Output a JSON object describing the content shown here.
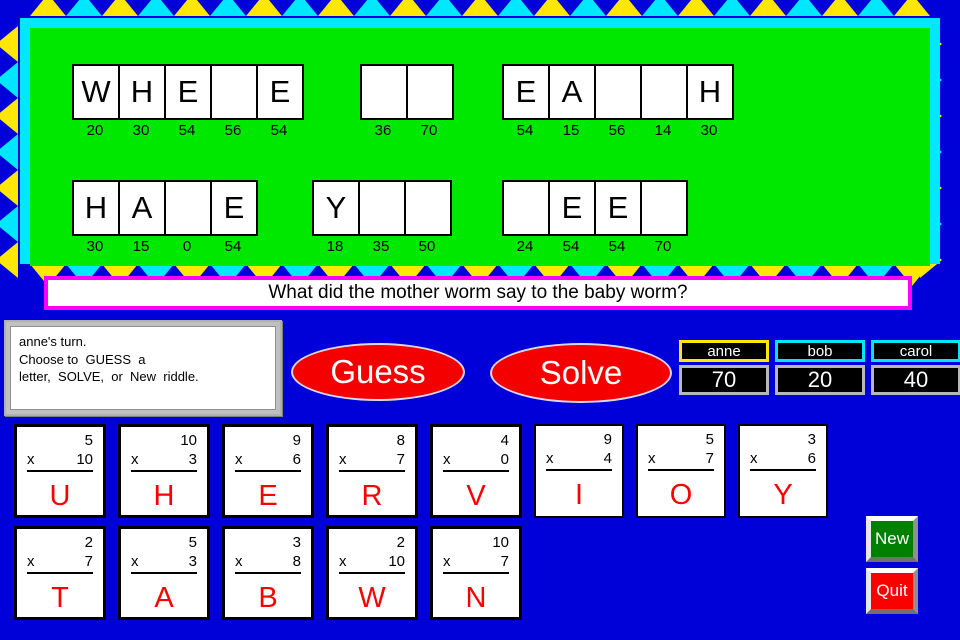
{
  "window": {
    "title": "Math Riddle Game"
  },
  "colors": {
    "background": "#0000d8",
    "panel": "#00e800",
    "frame_yellow": "#ffe800",
    "frame_cyan": "#00e8ff",
    "question_border": "#ff00ff",
    "button_red": "#f40000",
    "letter_red": "#fc0000",
    "new_green": "#008000",
    "active_player": "#ffe800",
    "inactive_player": "#00e8f8"
  },
  "puzzle": {
    "rows": [
      {
        "groups": [
          {
            "letters": [
              "W",
              "H",
              "E",
              "",
              "E"
            ],
            "numbers": [
              "20",
              "30",
              "54",
              "56",
              "54"
            ]
          },
          {
            "letters": [
              "",
              ""
            ],
            "numbers": [
              "36",
              "70"
            ]
          },
          {
            "letters": [
              "E",
              "A",
              "",
              "",
              "H"
            ],
            "numbers": [
              "54",
              "15",
              "56",
              "14",
              "30"
            ]
          }
        ]
      },
      {
        "groups": [
          {
            "letters": [
              "H",
              "A",
              "",
              "E"
            ],
            "numbers": [
              "30",
              "15",
              "0",
              "54"
            ]
          },
          {
            "letters": [
              "Y",
              "",
              ""
            ],
            "numbers": [
              "18",
              "35",
              "50"
            ]
          },
          {
            "letters": [
              "",
              "E",
              "E",
              ""
            ],
            "numbers": [
              "24",
              "54",
              "54",
              "70"
            ]
          }
        ]
      }
    ]
  },
  "question": {
    "text": "What did the mother worm say to the baby worm?"
  },
  "instructions": {
    "line1": "anne's turn.",
    "line2": "Choose to  GUESS  a",
    "line3": "letter,  SOLVE,  or  New  riddle."
  },
  "actions": {
    "guess_label": "Guess",
    "solve_label": "Solve"
  },
  "scoreboard": {
    "players": [
      {
        "name": "anne",
        "score": "70",
        "active": true
      },
      {
        "name": "bob",
        "score": "20",
        "active": false
      },
      {
        "name": "carol",
        "score": "40",
        "active": false
      }
    ]
  },
  "tiles": {
    "row1": [
      {
        "a": "5",
        "b": "10",
        "letter": "U",
        "thin": false
      },
      {
        "a": "10",
        "b": "3",
        "letter": "H",
        "thin": false
      },
      {
        "a": "9",
        "b": "6",
        "letter": "E",
        "thin": false
      },
      {
        "a": "8",
        "b": "7",
        "letter": "R",
        "thin": false
      },
      {
        "a": "4",
        "b": "0",
        "letter": "V",
        "thin": false
      },
      {
        "a": "9",
        "b": "4",
        "letter": "I",
        "thin": true
      },
      {
        "a": "5",
        "b": "7",
        "letter": "O",
        "thin": true
      },
      {
        "a": "3",
        "b": "6",
        "letter": "Y",
        "thin": true
      }
    ],
    "row2": [
      {
        "a": "2",
        "b": "7",
        "letter": "T",
        "thin": false
      },
      {
        "a": "5",
        "b": "3",
        "letter": "A",
        "thin": false
      },
      {
        "a": "3",
        "b": "8",
        "letter": "B",
        "thin": false
      },
      {
        "a": "2",
        "b": "10",
        "letter": "W",
        "thin": false
      },
      {
        "a": "10",
        "b": "7",
        "letter": "N",
        "thin": false
      }
    ],
    "operator": "x"
  },
  "controls": {
    "new_label": "New",
    "quit_label": "Quit"
  }
}
